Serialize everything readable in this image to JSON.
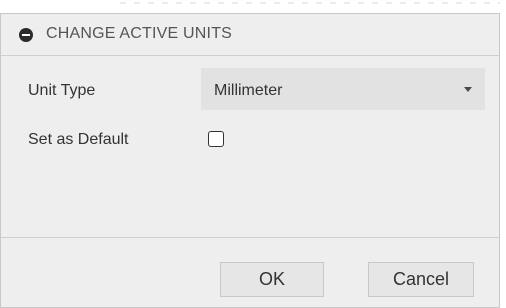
{
  "dialog": {
    "title": "CHANGE ACTIVE UNITS",
    "collapse_icon": "minus-circle-icon"
  },
  "fields": {
    "unit_type": {
      "label": "Unit Type",
      "value": "Millimeter",
      "dropdown_icon": "chevron-down-icon"
    },
    "set_as_default": {
      "label": "Set as Default",
      "checked": false
    }
  },
  "buttons": {
    "ok_label": "OK",
    "cancel_label": "Cancel"
  },
  "colors": {
    "dialog_bg": "#eeeeee",
    "select_bg": "#e2e2e2",
    "button_bg": "#e6e6e6",
    "border": "#c8c8c8",
    "text": "#333333",
    "title_text": "#555555"
  }
}
